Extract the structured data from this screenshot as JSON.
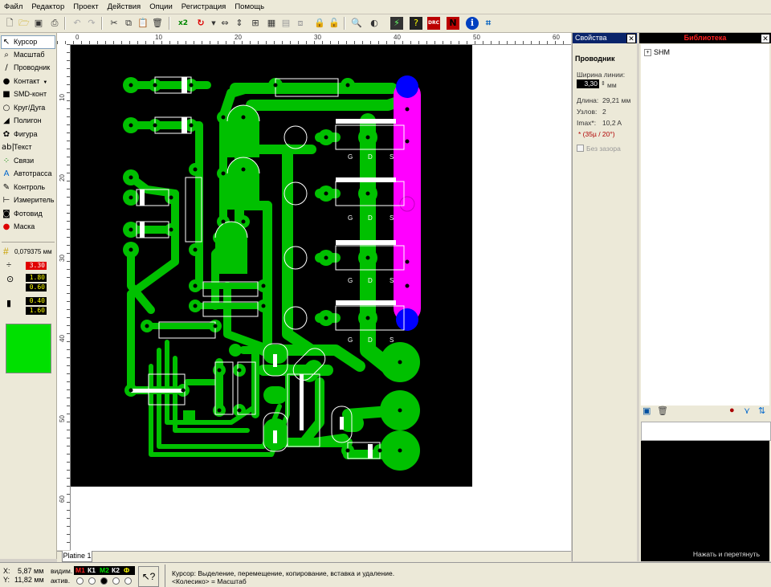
{
  "menu": [
    "Файл",
    "Редактор",
    "Проект",
    "Действия",
    "Опции",
    "Регистрация",
    "Помощь"
  ],
  "toolbar": {
    "icons": [
      "new-icon",
      "open-icon",
      "save-icon",
      "print-icon",
      "undo-icon",
      "redo-icon",
      "cut-icon",
      "copy-icon",
      "paste-icon",
      "delete-icon",
      "zoom-x2-icon",
      "rotate-icon",
      "mirror-h-icon",
      "mirror-v-icon",
      "align-icon",
      "group-icon",
      "ungroup-icon",
      "lock-icon",
      "unlock-icon",
      "layer-icon",
      "zoom-fit-icon",
      "contrast-icon",
      "ratsnest-icon",
      "drc-icon",
      "gerber-icon",
      "info-icon",
      "autoroute-icon"
    ],
    "zoom_label": "x2",
    "drc_label": "DRC"
  },
  "tools": [
    {
      "label": "Курсор",
      "icon": "cursor-icon",
      "glyph": "↖",
      "selected": true
    },
    {
      "label": "Масштаб",
      "icon": "zoom-icon",
      "glyph": "⌕"
    },
    {
      "label": "Проводник",
      "icon": "track-icon",
      "glyph": "∕"
    },
    {
      "label": "Контакт",
      "icon": "pad-icon",
      "glyph": "●",
      "dropdown": "▼"
    },
    {
      "label": "SMD-конт",
      "icon": "smd-pad-icon",
      "glyph": "■"
    },
    {
      "label": "Круг/Дуга",
      "icon": "circle-icon",
      "glyph": "○"
    },
    {
      "label": "Полигон",
      "icon": "polygon-icon",
      "glyph": "◢"
    },
    {
      "label": "Фигура",
      "icon": "shape-icon",
      "glyph": "✿"
    },
    {
      "label": "Текст",
      "icon": "text-icon",
      "glyph": "ab|"
    },
    {
      "label": "Связи",
      "icon": "connections-icon",
      "glyph": "⁘"
    },
    {
      "label": "Автотрасса",
      "icon": "autoroute-tool-icon",
      "glyph": "A"
    },
    {
      "label": "Контроль",
      "icon": "test-icon",
      "glyph": "✎"
    },
    {
      "label": "Измеритель",
      "icon": "measure-icon",
      "glyph": "⊢"
    },
    {
      "label": "Фотовид",
      "icon": "photoview-icon",
      "glyph": "◙"
    },
    {
      "label": "Маска",
      "icon": "mask-icon",
      "glyph": "●"
    }
  ],
  "grid_value": "0,079375 мм",
  "track_width": "3.30",
  "pad_outer": "1.80",
  "pad_inner": "0.60",
  "smd_w": "0.40",
  "smd_h": "1.60",
  "layer_color": "#00e000",
  "ruler_top": [
    "0",
    "10",
    "20",
    "30",
    "40",
    "50",
    "60"
  ],
  "ruler_left": [
    "10",
    "20",
    "30",
    "40",
    "50",
    "60"
  ],
  "tab": "Platine 1",
  "properties": {
    "title": "Свойства",
    "subtitle": "Проводник",
    "width_label": "Ширина линии:",
    "width_value": "3,30",
    "width_unit": "мм",
    "length_label": "Длина:",
    "length_value": "29,21 мм",
    "nodes_label": "Узлов:",
    "nodes_value": "2",
    "imax_label": "Imax*:",
    "imax_value": "10,2 A",
    "note": "* (35µ / 20°)",
    "noclearance_label": "Без зазора"
  },
  "library": {
    "title": "Библиотека",
    "tree_item": "SHM",
    "drag_hint": "Нажать и перетянуть"
  },
  "status": {
    "x_label": "X:",
    "x_value": "5,87 мм",
    "y_label": "Y:",
    "y_value": "11,82 мм",
    "visible_label": "видим.",
    "active_label": "актив.",
    "layers": [
      {
        "name": "М1",
        "color": "#ff2020"
      },
      {
        "name": "К1",
        "color": "#ffffff"
      },
      {
        "name": "М2",
        "color": "#00e000"
      },
      {
        "name": "К2",
        "color": "#ffffff"
      },
      {
        "name": "Ф",
        "color": "#ffff00"
      }
    ],
    "message_line1": "Курсор: Выделение, перемещение, копирование, вставка и удаление.",
    "message_line2": "<Колесико> = Масштаб"
  },
  "pcb": {
    "fet_labels": [
      "G",
      "D",
      "S"
    ]
  },
  "colors": {
    "board": "#000000",
    "copper": "#00c000",
    "highlight": "#ff00ff",
    "via_blue": "#0000ff"
  }
}
